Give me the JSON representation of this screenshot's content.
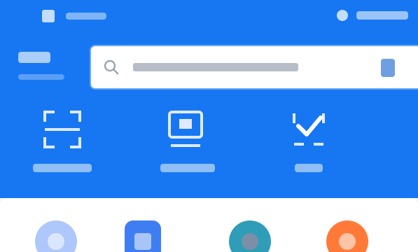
{
  "status_bar": {
    "left_text": "",
    "right_text": ""
  },
  "location": {
    "city": "",
    "subtitle": ""
  },
  "search": {
    "placeholder": "",
    "button_label": ""
  },
  "quick_actions": [
    {
      "label": "",
      "icon": "scan-frame-icon"
    },
    {
      "label": "",
      "icon": "card-reader-icon"
    },
    {
      "label": "",
      "icon": "check-mark-icon"
    }
  ],
  "app_icons": [
    {
      "icon": "clock-icon",
      "color": "#aec8fb"
    },
    {
      "icon": "document-icon",
      "color": "#3f7ef2"
    },
    {
      "icon": "globe-icon",
      "color": "#2f9db8"
    },
    {
      "icon": "orange-service-icon",
      "color": "#ff7a38"
    }
  ],
  "colors": {
    "header_background": "#1777f2",
    "strip_background": "#ffffff",
    "search_button": "#6f9fe0"
  }
}
